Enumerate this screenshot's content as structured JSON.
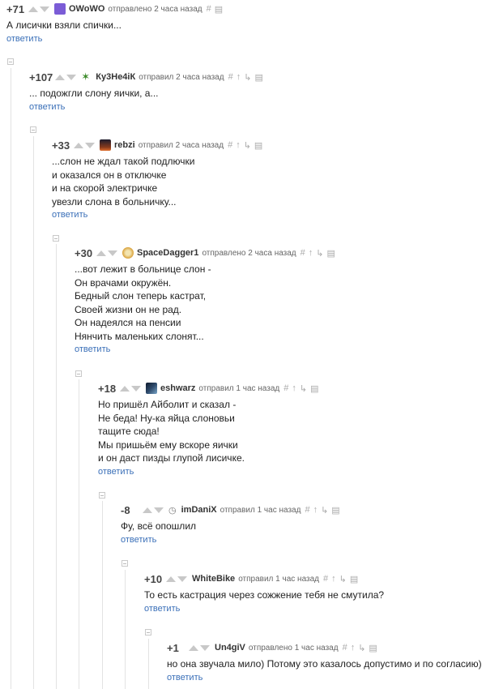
{
  "comments": [
    {
      "score": "+71",
      "user": "OWoWO",
      "meta": "отправлено 2 часа назад",
      "avatar_color": "#7b5cd6",
      "text": "А лисички взяли спички...",
      "reply": "ответить"
    },
    {
      "score": "+107",
      "user": "Ку3Не4іК",
      "meta": "отправил 2 часа назад",
      "avatar_color": "#3c8b2a",
      "text": "... подожгли слону яички, а...",
      "reply": "ответить"
    },
    {
      "score": "+33",
      "user": "rebzi",
      "meta": "отправил 2 часа назад",
      "avatar_color": "#8a3b1c",
      "text": "...слон не ждал такой подлючки\nи оказался он в отключке\nи на скорой электричке\nувезли слона в больничку...",
      "reply": "ответить"
    },
    {
      "score": "+30",
      "user": "SpaceDagger1",
      "meta": "отправлено 2 часа назад",
      "avatar_color": "#d9a13a",
      "text": "...вот лежит в больнице слон -\nОн врачами окружён.\nБедный слон теперь кастрат,\nСвоей жизни он не рад.\nОн надеялся на пенсии\nНянчить маленьких слонят...",
      "reply": "ответить"
    },
    {
      "score": "+18",
      "user": "eshwarz",
      "meta": "отправил 1 час назад",
      "avatar_color": "#2e4a6b",
      "text": "Но пришёл Айболит и сказал -\nНе беда! Ну-ка яйца слоновьи\nтащите сюда!\nМы пришьём ему вскоре яички\nи он даст пизды глупой лисичке.",
      "reply": "ответить"
    },
    {
      "score": "-8",
      "user": "imDaniX",
      "meta": "отправил 1 час назад",
      "avatar_color": "",
      "text": "Фу, всё опошлил",
      "reply": "ответить"
    },
    {
      "score": "+10",
      "user": "WhiteBike",
      "meta": "отправил 1 час назад",
      "avatar_color": "",
      "text": "То есть кастрация через сожжение тебя не смутила?",
      "reply": "ответить"
    },
    {
      "score": "+1",
      "user": "Un4giV",
      "meta": "отправлено 1 час назад",
      "avatar_color": "",
      "text": "но она звучала мило) Потому это казалось допустимо и по согласию)",
      "reply": "ответить"
    }
  ]
}
